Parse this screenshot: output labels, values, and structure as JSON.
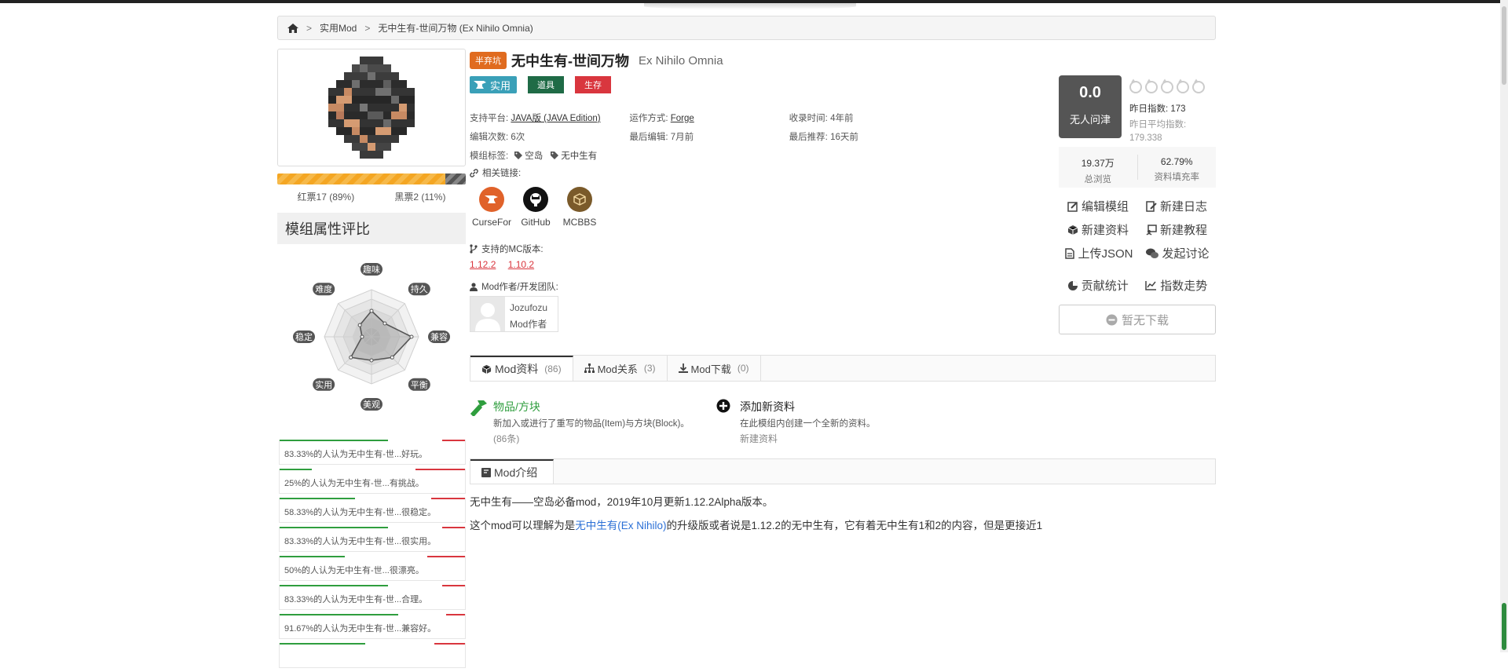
{
  "breadcrumb": {
    "items": [
      "实用Mod",
      "无中生有-世间万物 (Ex Nihilo Omnia)"
    ],
    "separator": ">"
  },
  "mod": {
    "status_badge": "半弃坑",
    "title": "无中生有-世间万物",
    "subtitle": "Ex Nihilo Omnia",
    "category_main": "实用",
    "category_tags": [
      {
        "label": "道具",
        "color": "#1f6b46"
      },
      {
        "label": "生存",
        "color": "#d9363e"
      }
    ]
  },
  "info": {
    "platform_label": "支持平台:",
    "platform_value": "JAVA版 (JAVA Edition)",
    "runtime_label": "运作方式:",
    "runtime_value": "Forge",
    "added_label": "收录时间:",
    "added_value": "4年前",
    "edits_label": "编辑次数:",
    "edits_value": "6次",
    "last_edit_label": "最后编辑:",
    "last_edit_value": "7月前",
    "last_rec_label": "最后推荐:",
    "last_rec_value": "16天前",
    "tags_label": "模组标签:",
    "tags": [
      "空岛",
      "无中生有"
    ]
  },
  "links": {
    "label": "相关链接:",
    "items": [
      {
        "name": "CurseFor",
        "icon": "curseforge-icon",
        "color": "#e0622a"
      },
      {
        "name": "GitHub",
        "icon": "github-icon",
        "color": "#111111"
      },
      {
        "name": "MCBBS",
        "icon": "mcbbs-icon",
        "color": "#7a5a2a"
      }
    ]
  },
  "versions": {
    "label": "支持的MC版本:",
    "items": [
      "1.12.2",
      "1.10.2"
    ]
  },
  "authors": {
    "label": "Mod作者/开发团队:",
    "name": "Jozufozu",
    "role": "Mod作者"
  },
  "votes": {
    "red_label": "红票17 (89%)",
    "black_label": "黑票2 (11%)",
    "red_fraction": 0.89
  },
  "attributes": {
    "header": "模组属性评比",
    "axes": [
      "趣味",
      "持久",
      "兼容",
      "平衡",
      "美观",
      "实用",
      "稳定",
      "难度"
    ]
  },
  "opinions": [
    {
      "text": "83.33%的人认为无中生有-世...好玩。",
      "pct": 83.33
    },
    {
      "text": "25%的人认为无中生有-世...有挑战。",
      "pct": 25
    },
    {
      "text": "58.33%的人认为无中生有-世...很稳定。",
      "pct": 58.33
    },
    {
      "text": "83.33%的人认为无中生有-世...很实用。",
      "pct": 83.33
    },
    {
      "text": "50%的人认为无中生有-世...很漂亮。",
      "pct": 50
    },
    {
      "text": "83.33%的人认为无中生有-世...合理。",
      "pct": 83.33
    },
    {
      "text": "91.67%的人认为无中生有-世...兼容好。",
      "pct": 91.67
    },
    {
      "text": "",
      "pct": 66
    }
  ],
  "score": {
    "value": "0.0",
    "label": "无人问津",
    "yesterday": "昨日指数: 173",
    "avg_label": "昨日平均指数:",
    "avg_value": "179.338"
  },
  "stats": [
    {
      "value": "19.37万",
      "label": "总浏览"
    },
    {
      "value": "62.79%",
      "label": "资料填充率"
    }
  ],
  "actions": [
    {
      "label": "编辑模组",
      "icon": "edit-icon"
    },
    {
      "label": "新建日志",
      "icon": "new-log-icon"
    },
    {
      "label": "新建资料",
      "icon": "cube-icon"
    },
    {
      "label": "新建教程",
      "icon": "tutorial-icon"
    },
    {
      "label": "上传JSON",
      "icon": "file-icon"
    },
    {
      "label": "发起讨论",
      "icon": "comments-icon"
    },
    {
      "label": "贡献统计",
      "icon": "pie-icon"
    },
    {
      "label": "指数走势",
      "icon": "line-chart-icon"
    }
  ],
  "download": {
    "label": "暂无下载"
  },
  "tabs": [
    {
      "label": "Mod资料",
      "count": "(86)"
    },
    {
      "label": "Mod关系",
      "count": "(3)"
    },
    {
      "label": "Mod下载",
      "count": "(0)"
    }
  ],
  "resources": [
    {
      "title": "物品/方块",
      "desc": "新加入或进行了重写的物品(Item)与方块(Block)。",
      "count": "(86条)",
      "icon": "hammer-icon"
    },
    {
      "title": "添加新资料",
      "desc": "在此模组内创建一个全新的资料。",
      "count": "新建资料",
      "icon": "plus-circle-icon"
    }
  ],
  "intro": {
    "tab_label": "Mod介绍",
    "line1": "无中生有——空岛必备mod，2019年10月更新1.12.2Alpha版本。",
    "line2_pre": "这个mod可以理解为是",
    "line2_link": "无中生有(Ex Nihilo)",
    "line2_post": "的升级版或者说是1.12.2的无中生有，它有着无中生有1和2的内容，但是更接近1"
  }
}
